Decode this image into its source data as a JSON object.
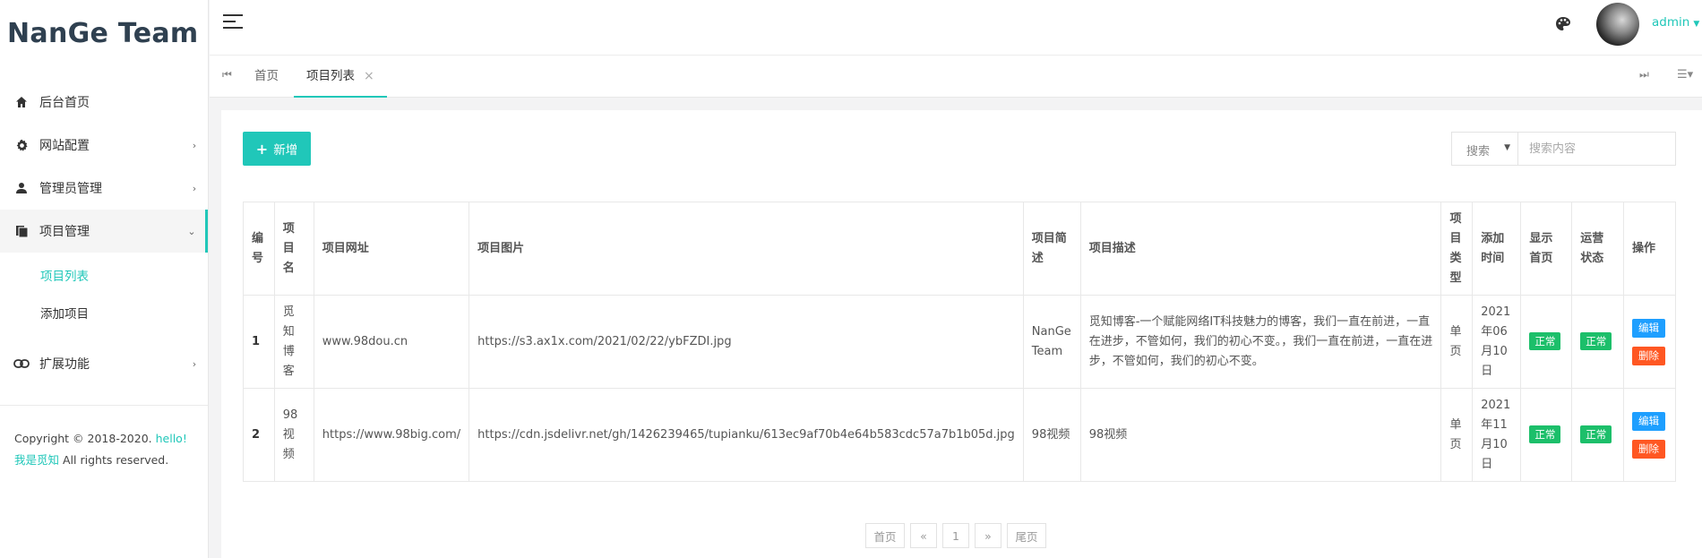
{
  "app": {
    "logo": "NanGe Team"
  },
  "sidebar": {
    "items": [
      {
        "label": "后台首页",
        "icon": "home-icon",
        "has_arrow": false
      },
      {
        "label": "网站配置",
        "icon": "gear-icon",
        "has_arrow": true
      },
      {
        "label": "管理员管理",
        "icon": "user-icon",
        "has_arrow": true
      },
      {
        "label": "项目管理",
        "icon": "book-icon",
        "has_arrow": true,
        "expanded": true
      },
      {
        "label": "扩展功能",
        "icon": "link-icon",
        "has_arrow": true
      }
    ],
    "submenu": [
      {
        "label": "项目列表",
        "current": true
      },
      {
        "label": "添加项目",
        "current": false
      }
    ],
    "copyright": {
      "prefix": "Copyright © 2018-2020.",
      "highlight": "hello! 我是觅知",
      "suffix": "All rights reserved."
    }
  },
  "header": {
    "user": "admin"
  },
  "tabs": {
    "home": "首页",
    "active": "项目列表",
    "close": "×"
  },
  "toolbar": {
    "add_label": "新增",
    "search_select": "搜索",
    "search_placeholder": "搜索内容"
  },
  "table": {
    "headers": {
      "id": "编号",
      "name": "项目名",
      "url": "项目网址",
      "image": "项目图片",
      "brief": "项目简述",
      "desc": "项目描述",
      "type": "项目类型",
      "time": "添加时间",
      "home": "显示首页",
      "status": "运营状态",
      "ops": "操作"
    },
    "rows": [
      {
        "id": "1",
        "name": "觅知博客",
        "url": "www.98dou.cn",
        "image": "https://s3.ax1x.com/2021/02/22/ybFZDI.jpg",
        "brief": "NanGe Team",
        "desc": "觅知博客-一个赋能网络IT科技魅力的博客，我们一直在前进，一直在进步，不管如何，我们的初心不变。，我们一直在前进，一直在进步，不管如何，我们的初心不变。",
        "type": "单页",
        "time": "2021年06月10日",
        "home": "正常",
        "status": "正常"
      },
      {
        "id": "2",
        "name": "98视频",
        "url": "https://www.98big.com/",
        "image": "https://cdn.jsdelivr.net/gh/1426239465/tupianku/613ec9af70b4e64b583cdc57a7b1b05d.jpg",
        "brief": "98视频",
        "desc": "98视频",
        "type": "单页",
        "time": "2021年11月10日",
        "home": "正常",
        "status": "正常"
      }
    ],
    "edit_label": "编辑",
    "delete_label": "删除"
  },
  "pagination": {
    "first": "首页",
    "prev": "«",
    "page": "1",
    "next": "»",
    "last": "尾页"
  },
  "colors": {
    "accent": "#20c7b9",
    "badge": "#1cbf6a",
    "edit": "#1e9fff",
    "delete": "#ff5722"
  }
}
